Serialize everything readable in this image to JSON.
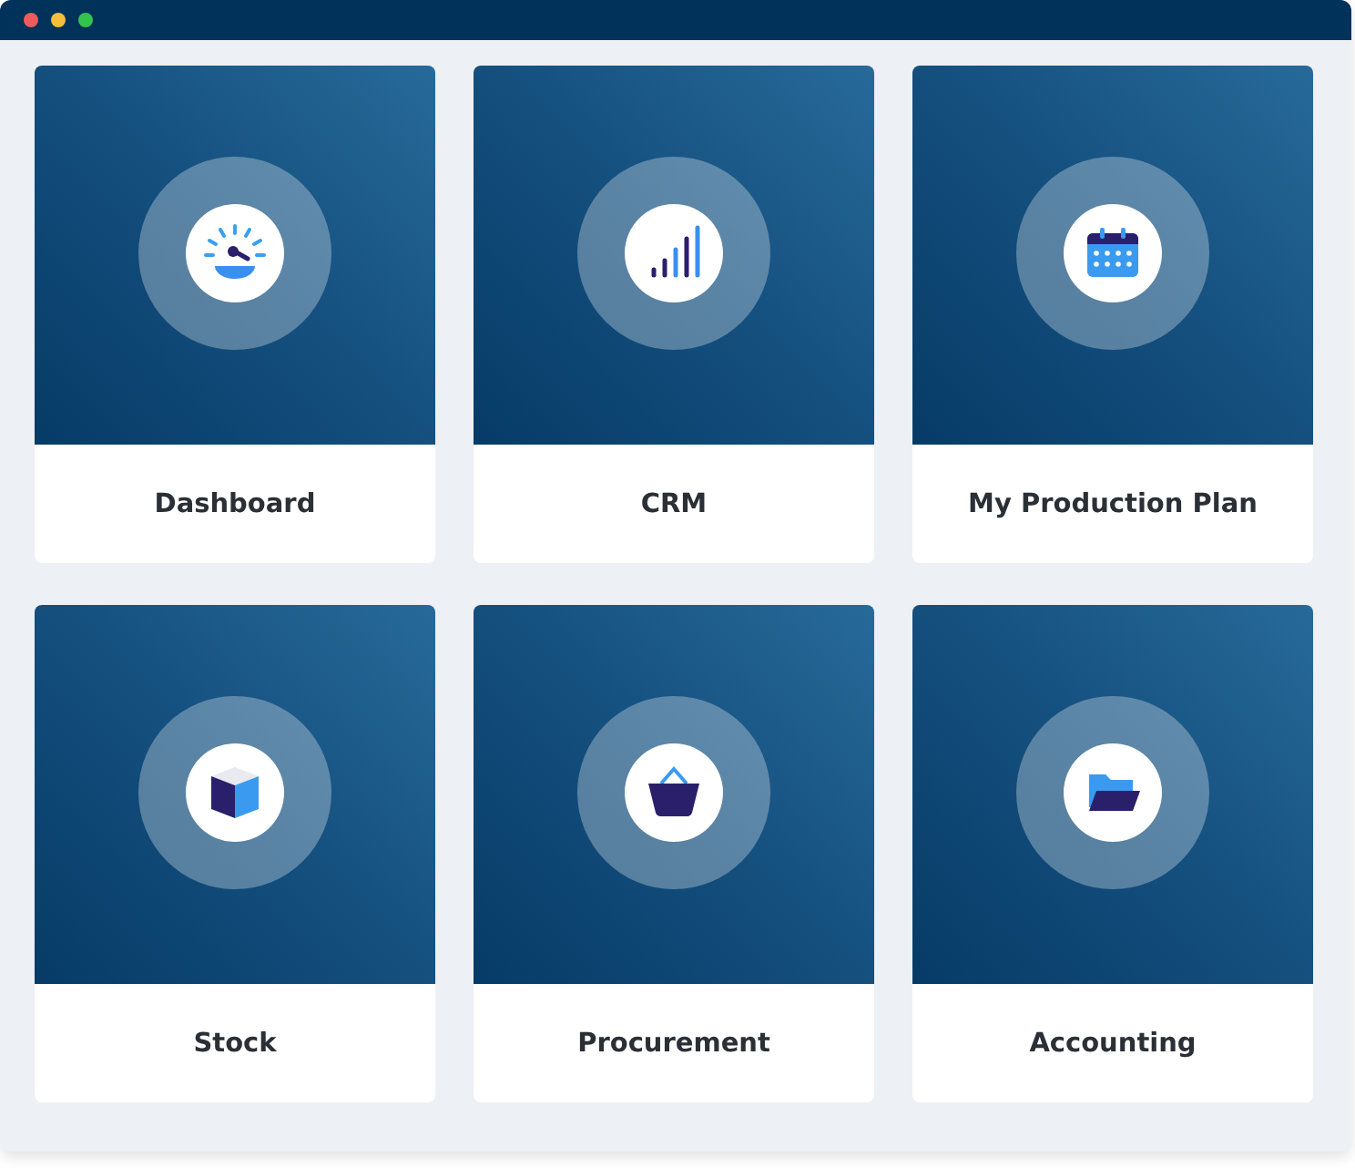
{
  "tiles": [
    {
      "label": "Dashboard",
      "kind": "gauge"
    },
    {
      "label": "CRM",
      "kind": "bars"
    },
    {
      "label": "My Production Plan",
      "kind": "calendar"
    },
    {
      "label": "Stock",
      "kind": "cube"
    },
    {
      "label": "Procurement",
      "kind": "basket"
    },
    {
      "label": "Accounting",
      "kind": "folder"
    }
  ]
}
